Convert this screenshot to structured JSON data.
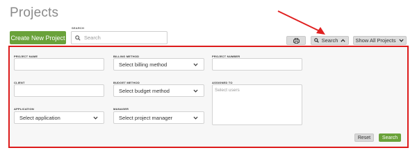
{
  "page": {
    "title": "Projects"
  },
  "toolbar": {
    "create_label": "Create New Project",
    "search_caption": "SEARCH",
    "search_placeholder": "Search",
    "print_icon": "printer-icon",
    "search_toggle_label": "Search",
    "show_all_label": "Show All Projects"
  },
  "filters": {
    "project_name": {
      "label": "PROJECT NAME",
      "value": ""
    },
    "billing_method": {
      "label": "BILLING METHOD",
      "value": "Select billing method"
    },
    "project_number": {
      "label": "PROJECT NUMBER",
      "value": ""
    },
    "client": {
      "label": "CLIENT",
      "value": ""
    },
    "budget_method": {
      "label": "BUDGET METHOD",
      "value": "Select budget method"
    },
    "assigned_to": {
      "label": "ASSIGNED TO",
      "placeholder": "Select users"
    },
    "application": {
      "label": "APPLICATION",
      "value": "Select application"
    },
    "manager": {
      "label": "MANAGER",
      "value": "Select project manager"
    }
  },
  "actions": {
    "reset_label": "Reset",
    "submit_label": "Search"
  },
  "colors": {
    "primary_green": "#6aa23a",
    "highlight_red": "#dd1a1a",
    "annotation_arrow": "#e02020"
  }
}
